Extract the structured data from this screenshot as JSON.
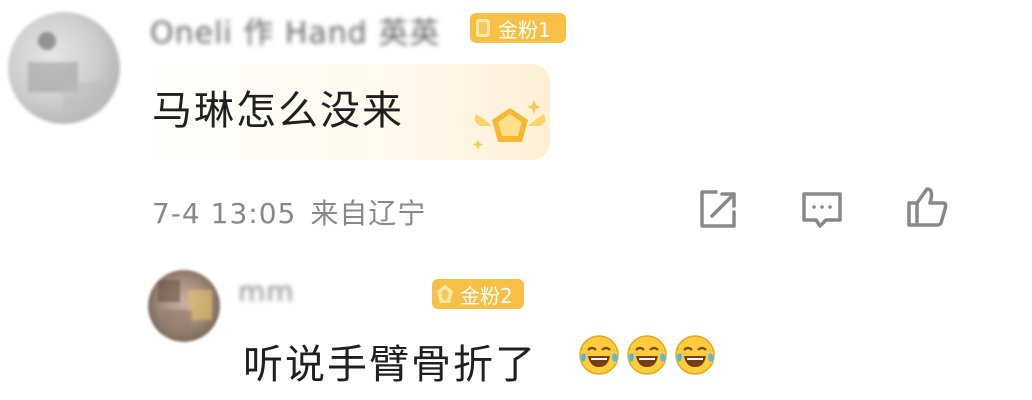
{
  "comment": {
    "username": "Oneli 作 Hand 英英",
    "badge_label": "金粉1",
    "text": "马琳怎么没来",
    "date": "7-4 13:05",
    "location": "来自辽宁"
  },
  "actions": {
    "share_icon": "share-icon",
    "comment_icon": "comment-icon",
    "like_icon": "like-icon"
  },
  "reply": {
    "username": "mm",
    "badge_label": "金粉2",
    "text": "听说手臂骨折了",
    "emoji_icon": "laughing-crying-emoji"
  },
  "colors": {
    "badge": "#f8bf47",
    "meta_text": "#888888",
    "icon": "#888888"
  }
}
